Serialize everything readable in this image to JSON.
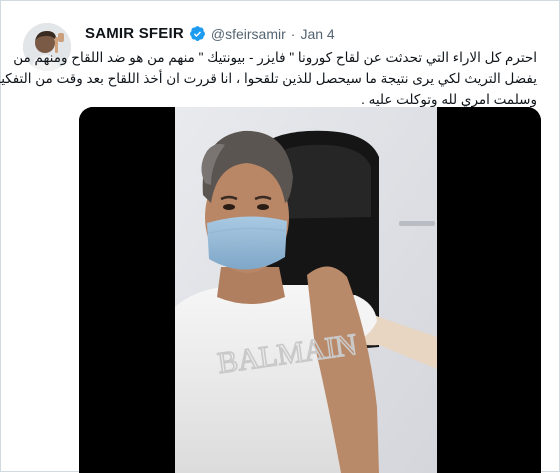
{
  "tweet": {
    "author_name": "SAMIR SFEIR",
    "handle": "@sfeirsamir",
    "separator": "·",
    "date": "Jan 4",
    "verified": true,
    "text_lines": [
      "احترم كل الاراء التي تحدثت عن لقاح كورونا \" فايزر - بيونتيك \" منهم من هو ضد اللقاح ومنهم من",
      "يفضل التريث لكي يرى نتيجة ما سيحصل للذين تلقحوا ، انا قررت ان أخذ اللقاح بعد وقت من التفكير",
      "وسلمت امري لله وتوكلت عليه ."
    ],
    "media": {
      "type": "video",
      "shirt_text": "BALMAIN"
    }
  },
  "colors": {
    "verified_blue": "#1d9bf0",
    "text_primary": "#0f1419",
    "text_secondary": "#536471",
    "border": "#cfd9de"
  }
}
